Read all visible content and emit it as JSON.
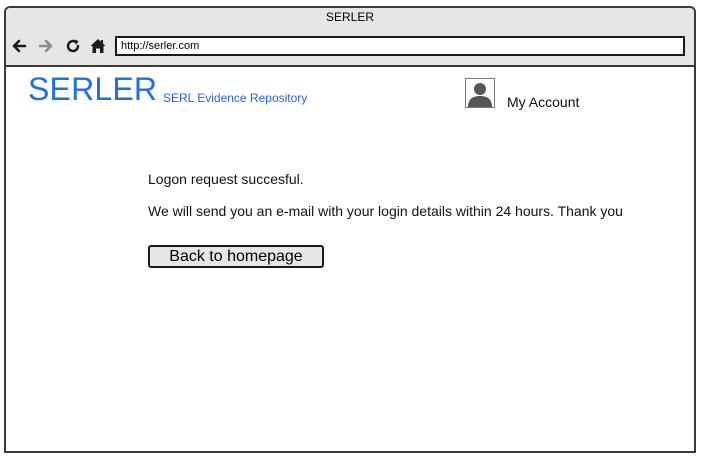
{
  "window": {
    "title": "SERLER"
  },
  "browser": {
    "url": "http://serler.com",
    "icons": [
      "back-arrow-icon",
      "forward-arrow-icon",
      "reload-icon",
      "home-icon"
    ]
  },
  "header": {
    "logo": "SERLER",
    "subtitle": "SERL Evidence Repository",
    "account_label": "My Account",
    "account_icon": "user-avatar-icon"
  },
  "content": {
    "message_line1": "Logon request succesful.",
    "message_line2": "We will send you an e-mail with your login details within 24 hours. Thank you",
    "back_button": "Back to homepage"
  },
  "colors": {
    "brand": "#1f6fe0",
    "chrome": "#e6e6e6",
    "border": "#3a3a3a"
  }
}
